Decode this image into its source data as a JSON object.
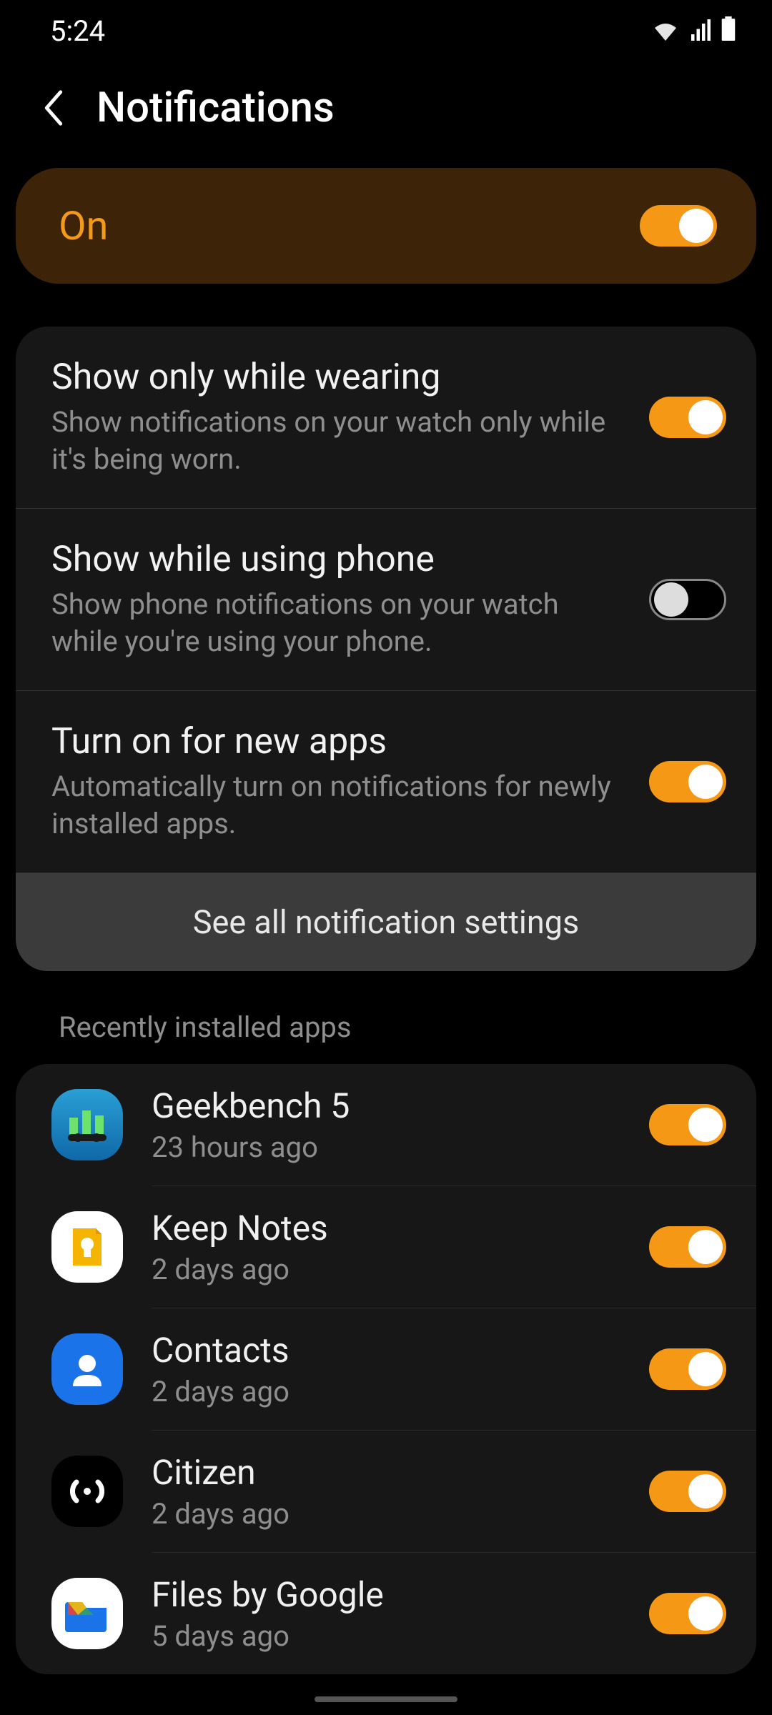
{
  "status": {
    "time": "5:24"
  },
  "header": {
    "title": "Notifications"
  },
  "master": {
    "label": "On",
    "enabled": true
  },
  "settings": [
    {
      "title": "Show only while wearing",
      "desc": "Show notifications on your watch only while it's being worn.",
      "enabled": true
    },
    {
      "title": "Show while using phone",
      "desc": "Show phone notifications on your watch while you're using your phone.",
      "enabled": false
    },
    {
      "title": "Turn on for new apps",
      "desc": "Automatically turn on notifications for newly installed apps.",
      "enabled": true
    }
  ],
  "see_all_label": "See all notification settings",
  "recent_label": "Recently installed apps",
  "apps": [
    {
      "name": "Geekbench 5",
      "time": "23 hours ago",
      "enabled": true,
      "icon": "geekbench"
    },
    {
      "name": "Keep Notes",
      "time": "2 days ago",
      "enabled": true,
      "icon": "keep"
    },
    {
      "name": "Contacts",
      "time": "2 days ago",
      "enabled": true,
      "icon": "contacts"
    },
    {
      "name": "Citizen",
      "time": "2 days ago",
      "enabled": true,
      "icon": "citizen"
    },
    {
      "name": "Files by Google",
      "time": "5 days ago",
      "enabled": true,
      "icon": "files"
    }
  ]
}
